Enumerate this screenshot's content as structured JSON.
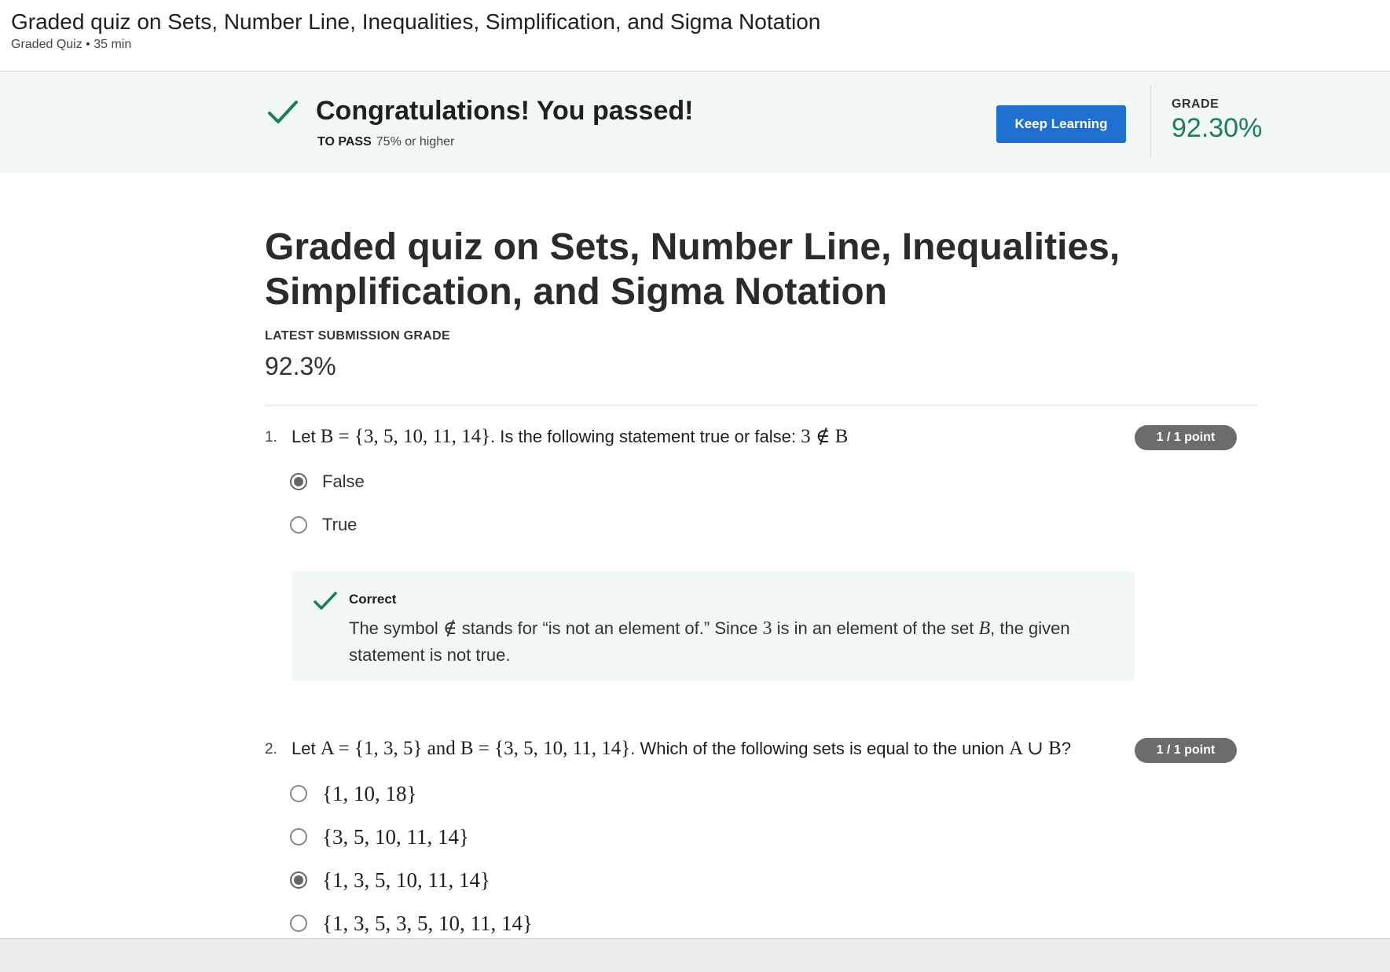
{
  "header": {
    "title": "Graded quiz on Sets, Number Line, Inequalities, Simplification, and Sigma Notation",
    "subtitle": "Graded Quiz • 35 min"
  },
  "banner": {
    "message": "Congratulations! You passed!",
    "to_pass_label": "TO PASS",
    "to_pass_value": "75% or higher",
    "button_label": "Keep Learning",
    "grade_label": "GRADE",
    "grade_value": "92.30%"
  },
  "main": {
    "title": "Graded quiz on Sets, Number Line, Inequalities, Simplification, and Sigma Notation",
    "latest_label": "LATEST SUBMISSION GRADE",
    "latest_value": "92.3%"
  },
  "questions": [
    {
      "number": "1.",
      "text_prefix": "Let",
      "math_1": "B = {3, 5, 10, 11, 14}",
      "text_middle": ". Is the following statement true or false:",
      "math_2": "3 ∉ B",
      "points": "1 / 1 point",
      "options": [
        {
          "label": "False",
          "selected": true
        },
        {
          "label": "True",
          "selected": false
        }
      ],
      "feedback": {
        "title": "Correct",
        "part1": "The symbol",
        "sym": "∉",
        "part2": "stands for “is not an element of.” Since",
        "num": "3",
        "part3": "is in an element of the set",
        "set": "B",
        "part4": ", the given statement is not true."
      }
    },
    {
      "number": "2.",
      "text_prefix": "Let",
      "math_1": "A = {1, 3, 5}",
      "text_and": "and",
      "math_2": "B = {3, 5, 10, 11, 14}",
      "text_middle": ". Which of the following sets is equal to the union",
      "math_3": "A ∪ B",
      "text_end": "?",
      "points": "1 / 1 point",
      "options": [
        {
          "label": "{1, 10, 18}",
          "selected": false
        },
        {
          "label": "{3, 5, 10, 11, 14}",
          "selected": false
        },
        {
          "label": "{1, 3, 5, 10, 11, 14}",
          "selected": true
        },
        {
          "label": "{1, 3, 5, 3, 5, 10, 11, 14}",
          "selected": false
        }
      ]
    }
  ],
  "colors": {
    "accent_green": "#1a7d5c",
    "button_blue": "#1f6fd1",
    "banner_bg": "#f1f7f5"
  },
  "icons": [
    "checkmark-icon",
    "radio-selected-icon",
    "radio-unselected-icon"
  ]
}
